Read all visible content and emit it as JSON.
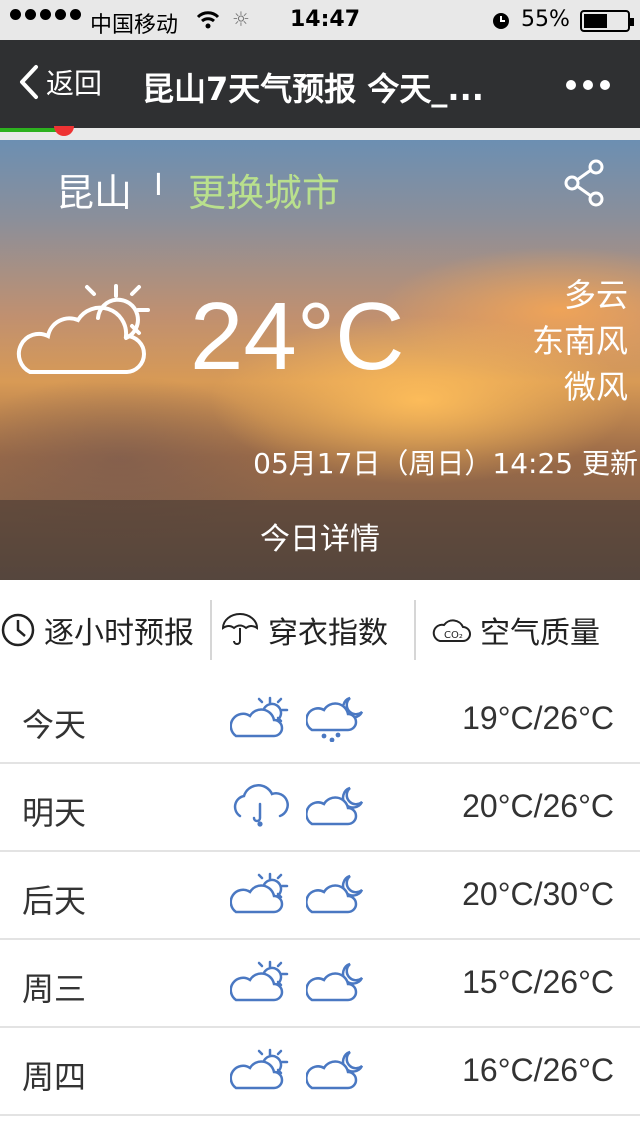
{
  "status_bar": {
    "carrier": "中国移动",
    "time": "14:47",
    "battery": "55%",
    "battery_level": 0.55
  },
  "nav": {
    "back_label": "返回",
    "title": "昆山7天气预报 今天_..."
  },
  "page_load_progress": 0.09,
  "hero": {
    "city": "昆山",
    "separator": "I",
    "change_city": "更换城市",
    "temperature": "24°C",
    "condition": "多云",
    "wind_direction": "东南风",
    "wind_level": "微风",
    "updated": "05月17日（周日）14:25 更新",
    "details_button": "今日详情"
  },
  "tabs": [
    {
      "label": "逐小时预报",
      "icon": "clock-icon"
    },
    {
      "label": "穿衣指数",
      "icon": "umbrella-icon"
    },
    {
      "label": "空气质量",
      "icon": "co2-cloud-icon"
    }
  ],
  "forecast": [
    {
      "day": "今天",
      "day_icon": "partly-cloudy-icon",
      "night_icon": "night-rain-icon",
      "range": "19°C/26°C"
    },
    {
      "day": "明天",
      "day_icon": "rain-icon",
      "night_icon": "night-cloudy-icon",
      "range": "20°C/26°C"
    },
    {
      "day": "后天",
      "day_icon": "partly-cloudy-icon",
      "night_icon": "night-cloudy-icon",
      "range": "20°C/30°C"
    },
    {
      "day": "周三",
      "day_icon": "partly-cloudy-icon",
      "night_icon": "night-cloudy-icon",
      "range": "15°C/26°C"
    },
    {
      "day": "周四",
      "day_icon": "partly-cloudy-icon",
      "night_icon": "night-cloudy-icon",
      "range": "16°C/26°C"
    }
  ],
  "colors": {
    "navbar": "#2f3032",
    "change_city": "#b9e08d",
    "forecast_icon": "#4a78c2",
    "progress": "#2db11f"
  }
}
